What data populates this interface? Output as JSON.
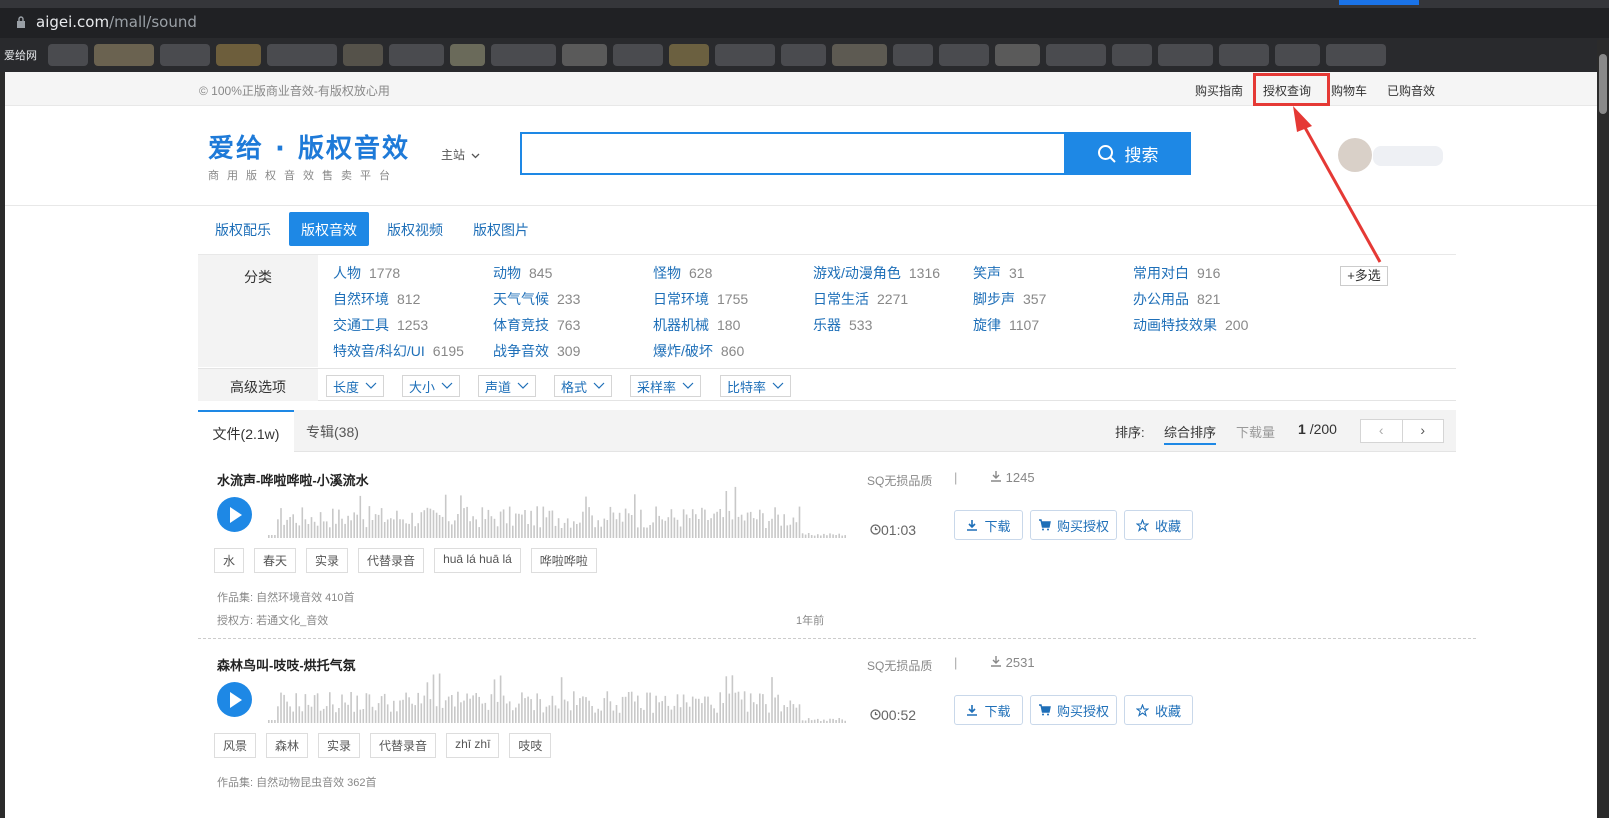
{
  "browser": {
    "url_domain": "aigei.com",
    "url_path": "/mall/sound",
    "bookmark_label": "爱给网"
  },
  "topbar": {
    "slogan": "© 100%正版商业音效-有版权放心用",
    "links": [
      "购买指南",
      "授权查询",
      "购物车",
      "已购音效"
    ]
  },
  "header": {
    "logo_main": "爱给 · 版权音效",
    "logo_sub": "商用版权音效售卖平台",
    "site_select": "主站",
    "search_button": "搜索"
  },
  "main_tabs": [
    "版权配乐",
    "版权音效",
    "版权视频",
    "版权图片"
  ],
  "filter": {
    "category_label": "分类",
    "categories": [
      {
        "name": "人物",
        "count": "1778"
      },
      {
        "name": "动物",
        "count": "845"
      },
      {
        "name": "怪物",
        "count": "628"
      },
      {
        "name": "游戏/动漫角色",
        "count": "1316"
      },
      {
        "name": "笑声",
        "count": "31"
      },
      {
        "name": "常用对白",
        "count": "916"
      },
      {
        "name": "自然环境",
        "count": "812"
      },
      {
        "name": "天气气候",
        "count": "233"
      },
      {
        "name": "日常环境",
        "count": "1755"
      },
      {
        "name": "日常生活",
        "count": "2271"
      },
      {
        "name": "脚步声",
        "count": "357"
      },
      {
        "name": "办公用品",
        "count": "821"
      },
      {
        "name": "交通工具",
        "count": "1253"
      },
      {
        "name": "体育竞技",
        "count": "763"
      },
      {
        "name": "机器机械",
        "count": "180"
      },
      {
        "name": "乐器",
        "count": "533"
      },
      {
        "name": "旋律",
        "count": "1107"
      },
      {
        "name": "动画特技效果",
        "count": "200"
      },
      {
        "name": "特效音/科幻/UI",
        "count": "6195"
      },
      {
        "name": "战争音效",
        "count": "309"
      },
      {
        "name": "爆炸/破坏",
        "count": "860"
      }
    ],
    "multi_select": "+多选",
    "advanced_label": "高级选项",
    "advanced_options": [
      "长度",
      "大小",
      "声道",
      "格式",
      "采样率",
      "比特率"
    ]
  },
  "list": {
    "tab_files": "文件(2.1w)",
    "tab_albums": "专辑(38)",
    "sort_label": "排序:",
    "sort_options": [
      "综合排序",
      "下载量"
    ],
    "page_current": "1",
    "page_total": "/200",
    "prev": "‹",
    "next": "›"
  },
  "items": [
    {
      "title": "水流声-哗啦哗啦-小溪流水",
      "quality": "SQ无损品质",
      "separator": "|",
      "downloads": "1245",
      "duration": "01:03",
      "download_btn": "下载",
      "buy_btn": "购买授权",
      "fav_btn": "收藏",
      "tags": [
        "水",
        "春天",
        "实录",
        "代替录音",
        "huā lá huā lá",
        "哗啦哗啦"
      ],
      "collection": "作品集: 自然环境音效 410首",
      "licensor": "授权方: 若通文化_音效",
      "time_ago": "1年前"
    },
    {
      "title": "森林鸟叫-吱吱-烘托气氛",
      "quality": "SQ无损品质",
      "separator": "|",
      "downloads": "2531",
      "duration": "00:52",
      "download_btn": "下载",
      "buy_btn": "购买授权",
      "fav_btn": "收藏",
      "tags": [
        "风景",
        "森林",
        "实录",
        "代替录音",
        "zhī zhī",
        "吱吱"
      ],
      "collection": "作品集: 自然动物昆虫音效 362首"
    }
  ],
  "colors": {
    "accent": "#1e88e5",
    "link": "#1e6fb8",
    "annotation": "#e53935"
  }
}
